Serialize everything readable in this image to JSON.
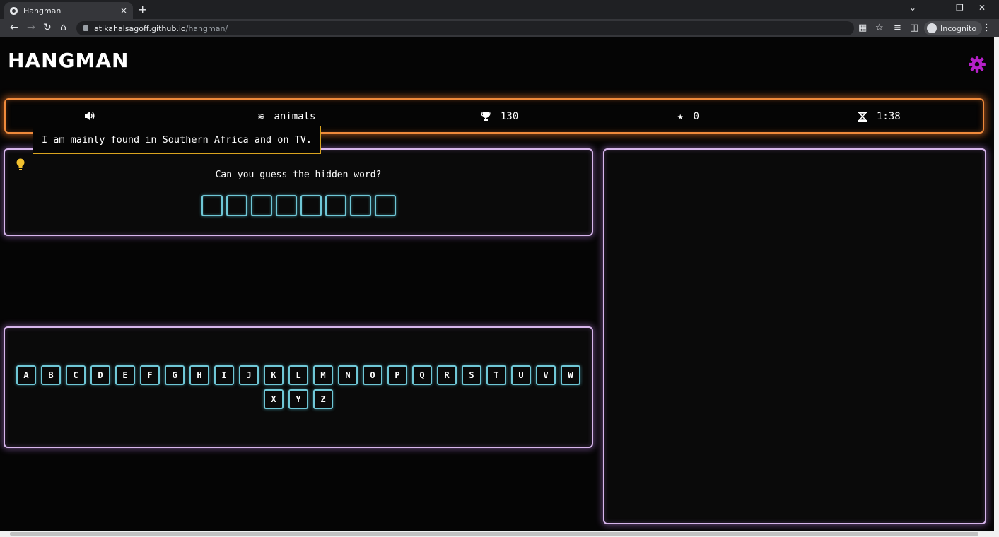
{
  "browser": {
    "tab_title": "Hangman",
    "tab_close": "×",
    "new_tab": "+",
    "url_host": "atikahalsagoff.github.io",
    "url_path": "/hangman/",
    "incognito_label": "Incognito"
  },
  "header": {
    "logo": "HANGMAN"
  },
  "stats": {
    "category": "animals",
    "score": "130",
    "stars": "0",
    "timer": "1:38"
  },
  "hint": {
    "text": "I am mainly found in Southern Africa and on TV."
  },
  "word": {
    "prompt": "Can you guess the hidden word?",
    "slot_count": 8
  },
  "keyboard": {
    "letters": [
      "A",
      "B",
      "C",
      "D",
      "E",
      "F",
      "G",
      "H",
      "I",
      "J",
      "K",
      "L",
      "M",
      "N",
      "O",
      "P",
      "Q",
      "R",
      "S",
      "T",
      "U",
      "V",
      "W",
      "X",
      "Y",
      "Z"
    ]
  },
  "colors": {
    "stat_border": "#f08a3b",
    "panel_border": "#d7b6ec",
    "key_border": "#6fc7d6",
    "hint_border": "#d9a41f",
    "gear": "#b620c9",
    "bulb": "#f2c12e"
  }
}
